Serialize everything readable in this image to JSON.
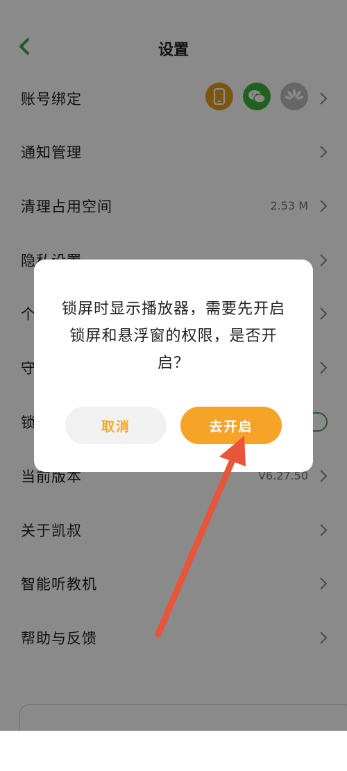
{
  "header": {
    "title": "设置"
  },
  "settings": {
    "rows": [
      {
        "label": "账号绑定",
        "value": ""
      },
      {
        "label": "通知管理",
        "value": ""
      },
      {
        "label": "清理占用空间",
        "value": "2.53 M"
      },
      {
        "label": "隐私设置",
        "value": ""
      },
      {
        "label": "个",
        "value": ""
      },
      {
        "label": "守",
        "value": ""
      },
      {
        "label": "锁",
        "value": ""
      },
      {
        "label": "当前版本",
        "value": "V6.27.50"
      },
      {
        "label": "关于凯叔",
        "value": ""
      },
      {
        "label": "智能听教机",
        "value": ""
      },
      {
        "label": "帮助与反馈",
        "value": ""
      }
    ]
  },
  "account_icons": [
    "phone-icon",
    "wechat-icon",
    "huawei-icon"
  ],
  "colors": {
    "accent_green": "#3da64b",
    "phone_icon_bg": "#e6a01e",
    "wechat_icon_bg": "#3eb33a",
    "huawei_icon_bg": "#bdbdbd",
    "dialog_button_orange": "#f6a427",
    "annotation_arrow": "#e8553a"
  },
  "dialog": {
    "message": "锁屏时显示播放器，需要先开启锁屏和悬浮窗的权限，是否开启？",
    "cancel_label": "取消",
    "confirm_label": "去开启"
  }
}
